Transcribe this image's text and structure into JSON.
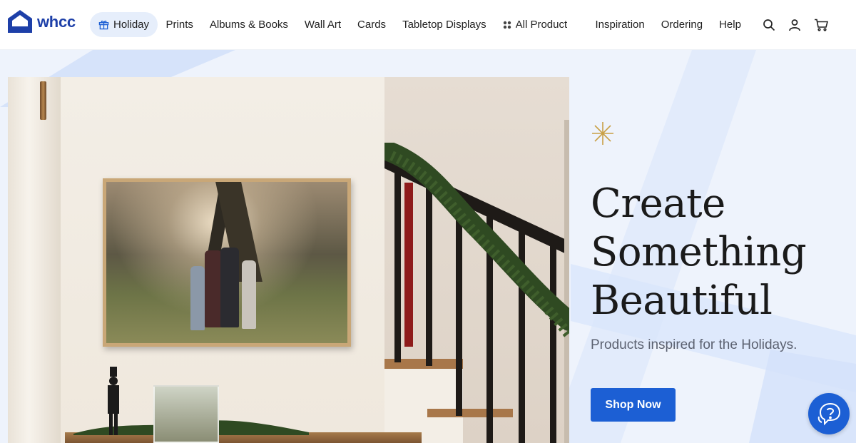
{
  "brand": {
    "name": "whcc",
    "color": "#1d3fa8"
  },
  "nav": {
    "items": [
      {
        "label": "Holiday",
        "icon": "gift-icon",
        "active": true
      },
      {
        "label": "Prints"
      },
      {
        "label": "Albums & Books"
      },
      {
        "label": "Wall Art"
      },
      {
        "label": "Cards"
      },
      {
        "label": "Tabletop Displays"
      },
      {
        "label": "All Products",
        "icon": "grid-dots-icon"
      }
    ],
    "secondary": [
      {
        "label": "Inspiration"
      },
      {
        "label": "Ordering"
      },
      {
        "label": "Help"
      }
    ],
    "icons": [
      "search-icon",
      "account-icon",
      "cart-icon"
    ]
  },
  "hero": {
    "headline": [
      "Create",
      "Something",
      "Beautiful"
    ],
    "subtitle": "Products inspired for the Holidays.",
    "cta_label": "Shop Now",
    "sparkle_icon": "sparkle-icon",
    "accent_color": "#1c5fd4",
    "background_color": "#eef3fc"
  },
  "help_widget": {
    "icon": "help-chat-icon"
  }
}
